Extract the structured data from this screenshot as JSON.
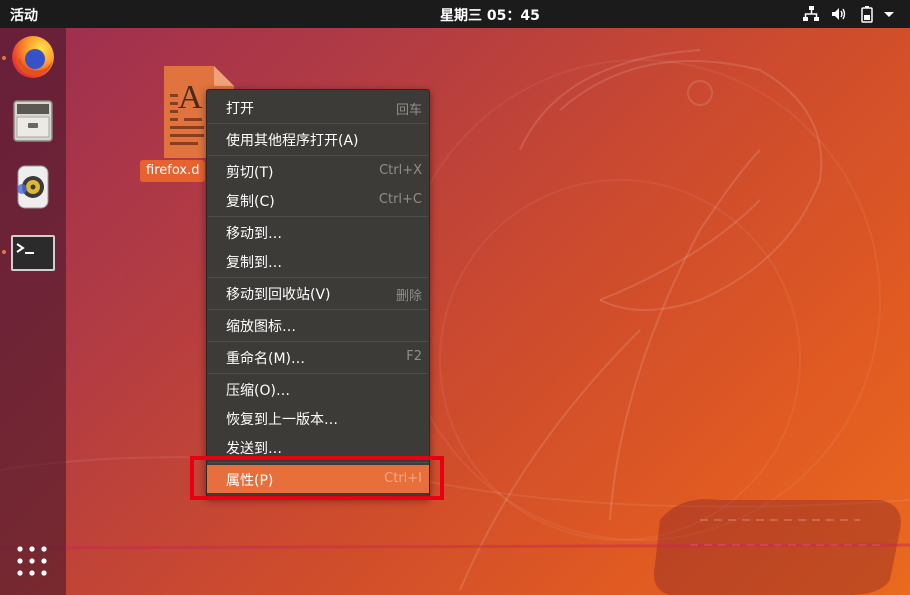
{
  "topbar": {
    "activities_label": "活动",
    "clock": "星期三 05：45",
    "tray_icons": [
      "network-icon",
      "volume-icon",
      "battery-icon",
      "dropdown-arrow-icon"
    ]
  },
  "dock": {
    "items": [
      {
        "name": "firefox",
        "icon": "firefox-icon",
        "running": true
      },
      {
        "name": "files",
        "icon": "file-cabinet-icon",
        "running": false
      },
      {
        "name": "rhythmbox",
        "icon": "speaker-icon",
        "running": false
      },
      {
        "name": "terminal",
        "icon": "terminal-icon",
        "running": true
      }
    ],
    "app_grid_icon": "app-grid-icon"
  },
  "desktop": {
    "file_label": "firefox.d"
  },
  "context_menu": {
    "items": [
      {
        "label": "打开",
        "accel": "回车"
      },
      {
        "label": "使用其他程序打开(A)",
        "accel": ""
      },
      {
        "label": "剪切(T)",
        "accel": "Ctrl+X"
      },
      {
        "label": "复制(C)",
        "accel": "Ctrl+C"
      },
      {
        "label": "移动到…",
        "accel": ""
      },
      {
        "label": "复制到…",
        "accel": ""
      },
      {
        "label": "移动到回收站(V)",
        "accel": "删除"
      },
      {
        "label": "缩放图标…",
        "accel": ""
      },
      {
        "label": "重命名(M)…",
        "accel": "F2"
      },
      {
        "label": "压缩(O)…",
        "accel": ""
      },
      {
        "label": "恢复到上一版本…",
        "accel": ""
      },
      {
        "label": "发送到…",
        "accel": ""
      },
      {
        "label": "属性(P)",
        "accel": "Ctrl+I",
        "highlighted": true
      }
    ]
  },
  "colors": {
    "menu_bg": "#3c3b37",
    "menu_highlight": "#e76f3c",
    "annotation_box": "#e60012",
    "topbar_bg": "#1b1b1b"
  }
}
